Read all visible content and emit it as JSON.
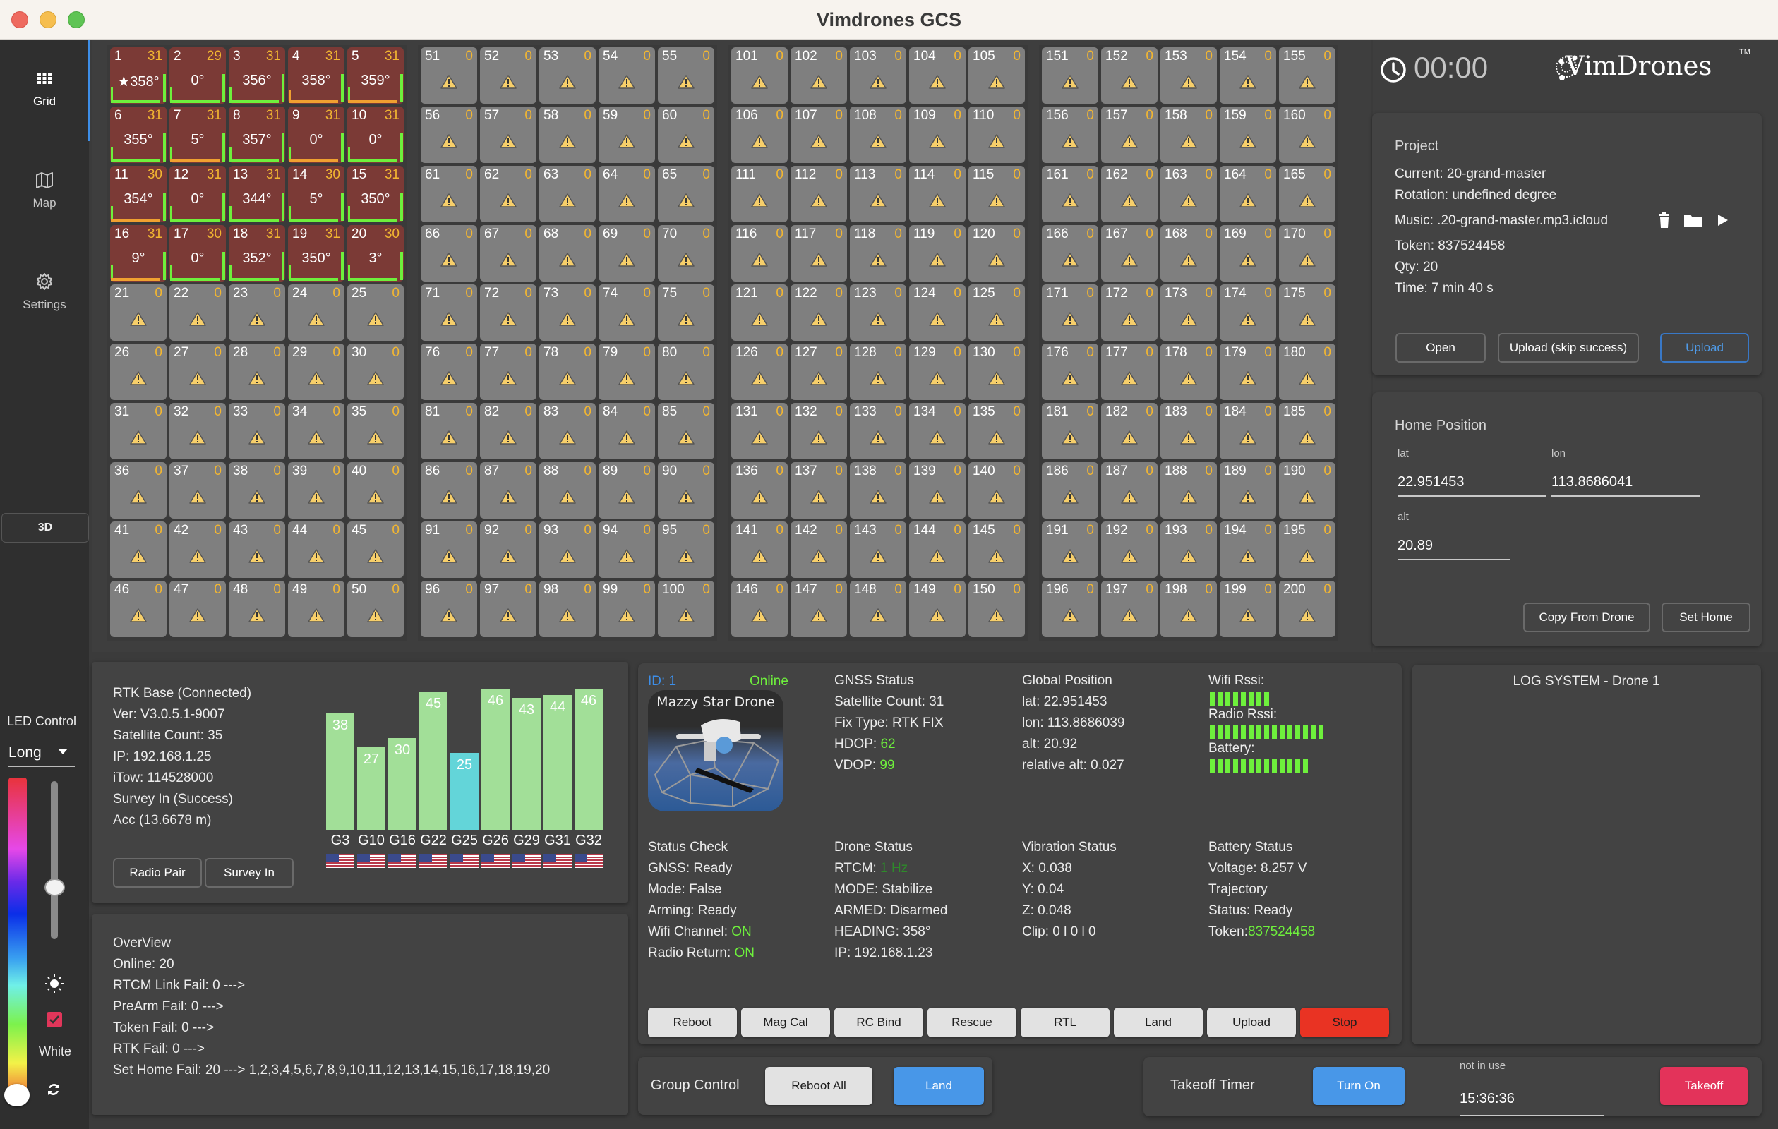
{
  "window": {
    "title": "Vimdrones GCS"
  },
  "sidebar": {
    "items": [
      {
        "label": "Grid",
        "icon": "grid-icon",
        "active": true
      },
      {
        "label": "Map",
        "icon": "map-icon",
        "active": false
      },
      {
        "label": "Settings",
        "icon": "gear-icon",
        "active": false
      }
    ],
    "btn_3d": "3D",
    "led": {
      "title": "LED Control",
      "mode": "Long",
      "brightness": 0.25,
      "hue_position": 1.0,
      "white_checked": true,
      "white_label": "White"
    }
  },
  "grid": {
    "active_drones": [
      {
        "id": "1",
        "sat": "31",
        "heading": "★358°",
        "left": "green",
        "bottom": "green"
      },
      {
        "id": "2",
        "sat": "29",
        "heading": "0°",
        "left": "green",
        "bottom": "green"
      },
      {
        "id": "3",
        "sat": "31",
        "heading": "356°",
        "left": "green",
        "bottom": "green"
      },
      {
        "id": "4",
        "sat": "31",
        "heading": "358°",
        "left": "orange",
        "bottom": "orange"
      },
      {
        "id": "5",
        "sat": "31",
        "heading": "359°",
        "left": "green",
        "bottom": "orange"
      },
      {
        "id": "6",
        "sat": "31",
        "heading": "355°",
        "left": "green",
        "bottom": "green"
      },
      {
        "id": "7",
        "sat": "31",
        "heading": "5°",
        "left": "green",
        "bottom": "orange"
      },
      {
        "id": "8",
        "sat": "31",
        "heading": "357°",
        "left": "green",
        "bottom": "green"
      },
      {
        "id": "9",
        "sat": "31",
        "heading": "0°",
        "left": "green",
        "bottom": "orange"
      },
      {
        "id": "10",
        "sat": "31",
        "heading": "0°",
        "left": "green",
        "bottom": "green"
      },
      {
        "id": "11",
        "sat": "30",
        "heading": "354°",
        "left": "green",
        "bottom": "orange"
      },
      {
        "id": "12",
        "sat": "31",
        "heading": "0°",
        "left": "green",
        "bottom": "green"
      },
      {
        "id": "13",
        "sat": "31",
        "heading": "344°",
        "left": "green",
        "bottom": "green"
      },
      {
        "id": "14",
        "sat": "30",
        "heading": "5°",
        "left": "green",
        "bottom": "green"
      },
      {
        "id": "15",
        "sat": "31",
        "heading": "350°",
        "left": "green",
        "bottom": "green"
      },
      {
        "id": "16",
        "sat": "31",
        "heading": "9°",
        "left": "green",
        "bottom": "orange"
      },
      {
        "id": "17",
        "sat": "30",
        "heading": "0°",
        "left": "green",
        "bottom": "green"
      },
      {
        "id": "18",
        "sat": "31",
        "heading": "352°",
        "left": "green",
        "bottom": "green"
      },
      {
        "id": "19",
        "sat": "31",
        "heading": "350°",
        "left": "green",
        "bottom": "green"
      },
      {
        "id": "20",
        "sat": "30",
        "heading": "3°",
        "left": "green",
        "bottom": "green"
      }
    ],
    "total_slots": 200,
    "offline_sat": "0",
    "colors": {
      "active_tile": "#7b3a36",
      "offline_tile": "#7f7f7f",
      "sat": "#f2b631",
      "ok": "#6ef03c",
      "warn": "#f0a030"
    }
  },
  "header": {
    "timer": "00:00",
    "logo": "VimDrones",
    "tm": "TM"
  },
  "project": {
    "title": "Project",
    "current": "Current: 20-grand-master",
    "rotation": "Rotation: undefined degree",
    "music": "Music: .20-grand-master.mp3.icloud",
    "token": "Token: 837524458",
    "qty": "Qty: 20",
    "time": "Time: 7 min 40 s",
    "buttons": {
      "open": "Open",
      "upload_skip": "Upload (skip success)",
      "upload": "Upload"
    }
  },
  "home": {
    "title": "Home Position",
    "lat_label": "lat",
    "lat": "22.951453",
    "lon_label": "lon",
    "lon": "113.8686041",
    "alt_label": "alt",
    "alt": "20.89",
    "buttons": {
      "copy": "Copy From Drone",
      "set": "Set Home"
    }
  },
  "rtk": {
    "lines": [
      "RTK Base (Connected)",
      "Ver: V3.0.5.1-9007",
      "Satellite Count: 35",
      "IP: 192.168.1.25",
      "iTow: 114528000",
      "Survey In (Success)",
      "Acc (13.6678 m)"
    ],
    "buttons": {
      "radio_pair": "Radio Pair",
      "survey_in": "Survey In"
    }
  },
  "chart_data": {
    "type": "bar",
    "title": "",
    "categories": [
      "G3",
      "G10",
      "G16",
      "G22",
      "G25",
      "G26",
      "G29",
      "G31",
      "G32"
    ],
    "values": [
      38,
      27,
      30,
      45,
      25,
      46,
      43,
      44,
      46
    ],
    "highlight": [
      "G25"
    ],
    "ylim": [
      0,
      46
    ],
    "xlabel": "",
    "ylabel": "",
    "colors": {
      "normal": "#a2df98",
      "low": "#63d5d9"
    }
  },
  "overview": {
    "lines": [
      "OverView",
      "Online: 20",
      "RTCM Link Fail: 0 --->",
      "PreArm Fail: 0 --->",
      "Token Fail: 0 --->",
      "RTK Fail: 0 --->",
      "Set Home Fail: 20 ---> 1,2,3,4,5,6,7,8,9,10,11,12,13,14,15,16,17,18,19,20"
    ]
  },
  "drone": {
    "id": "ID: 1",
    "status": "Online",
    "name": "Mazzy Star Drone",
    "gnss": {
      "title": "GNSS Status",
      "sat": "Satellite Count: 31",
      "fix": "Fix Type: RTK FIX",
      "hdop_label": "HDOP: ",
      "hdop": "62",
      "vdop_label": "VDOP: ",
      "vdop": "99"
    },
    "position": {
      "title": "Global Position",
      "lat": "lat: 22.951453",
      "lon": "lon: 113.8686039",
      "alt": "alt: 20.92",
      "rel_alt": "relative alt: 0.027"
    },
    "signals": {
      "wifi_label": "Wifi Rssi:",
      "wifi_bars": 8,
      "radio_label": "Radio Rssi:",
      "radio_bars": 15,
      "battery_label": "Battery:",
      "battery_bars": 13
    },
    "status_check": {
      "title": "Status Check",
      "gnss": "GNSS: Ready",
      "mode": "Mode: False",
      "arming": "Arming: Ready",
      "wifi_label": "Wifi Channel: ",
      "wifi": "ON",
      "radio_label": "Radio Return: ",
      "radio": "ON"
    },
    "drone_status": {
      "title": "Drone Status",
      "rtcm_label": "RTCM: ",
      "rtcm": "1 Hz",
      "mode": "MODE: Stabilize",
      "armed": "ARMED: Disarmed",
      "heading": "HEADING: 358°",
      "ip": "IP: 192.168.1.23"
    },
    "vibration": {
      "title": "Vibration Status",
      "x": "X: 0.038",
      "y": "Y: 0.04",
      "z": "Z: 0.048",
      "clip": "Clip: 0 l 0 l 0"
    },
    "battery": {
      "title": "Battery Status",
      "voltage": "Voltage: 8.257 V",
      "trajectory": "Trajectory",
      "status": "Status: Ready",
      "token_label": "Token:",
      "token": "837524458"
    },
    "buttons": [
      "Reboot",
      "Mag Cal",
      "RC Bind",
      "Rescue",
      "RTL",
      "Land",
      "Upload",
      "Stop"
    ]
  },
  "log": {
    "title": "LOG SYSTEM - Drone 1"
  },
  "group": {
    "title": "Group Control",
    "reboot_all": "Reboot All",
    "land": "Land"
  },
  "takeoff": {
    "title": "Takeoff Timer",
    "turn_on": "Turn On",
    "time_label": "not in use",
    "time": "15:36:36",
    "takeoff": "Takeoff"
  }
}
